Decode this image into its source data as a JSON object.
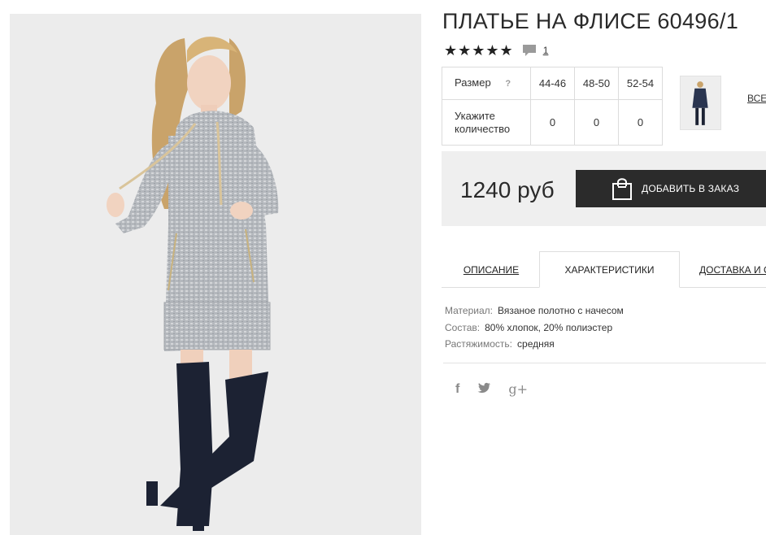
{
  "product": {
    "title": "ПЛАТЬЕ НА ФЛИСЕ 60496/1",
    "stars": "★★★★★",
    "review_count": "1"
  },
  "size_table": {
    "size_label": "Размер",
    "help": "?",
    "sizes": [
      "44-46",
      "48-50",
      "52-54"
    ],
    "qty_label_line1": "Укажите",
    "qty_label_line2": "количество",
    "quantities": [
      "0",
      "0",
      "0"
    ]
  },
  "gallery": {
    "all_link": "ВСЕ"
  },
  "price": {
    "amount": "1240 руб",
    "button_label": "ДОБАВИТЬ В ЗАКАЗ"
  },
  "tabs": [
    {
      "label": "ОПИСАНИЕ"
    },
    {
      "label": "ХАРАКТЕРИСТИКИ"
    },
    {
      "label": "ДОСТАВКА И ОПЛАТА"
    }
  ],
  "specs": [
    {
      "key": "Материал:",
      "value": "Вязаное полотно с начесом"
    },
    {
      "key": "Состав:",
      "value": "80% хлопок, 20% полиэстер"
    },
    {
      "key": "Растяжимость:",
      "value": "средняя"
    }
  ],
  "social": {
    "facebook": "f",
    "twitter": "🐦",
    "google": "g+"
  },
  "colors": {
    "button_bg": "#2b2b2b",
    "panel_bg": "#efefef",
    "dress": "#b9bcc0",
    "boots": "#1c2233"
  }
}
